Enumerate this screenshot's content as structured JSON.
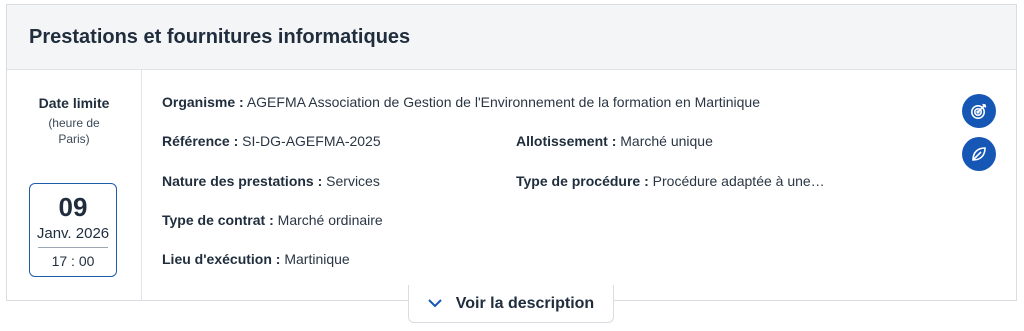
{
  "card": {
    "title": "Prestations et fournitures informatiques"
  },
  "deadline": {
    "label": "Date limite",
    "timezone": "(heure de Paris)",
    "day": "09",
    "month_year": "Janv. 2026",
    "time": "17 : 00"
  },
  "details": {
    "organisme": {
      "label": "Organisme :",
      "value": "AGEFMA Association de Gestion de l'Environnement de la formation en Martinique"
    },
    "reference": {
      "label": "Référence :",
      "value": "SI-DG-AGEFMA-2025"
    },
    "allotissement": {
      "label": "Allotissement :",
      "value": "Marché unique"
    },
    "nature": {
      "label": "Nature des prestations :",
      "value": "Services"
    },
    "procedure": {
      "label": "Type de procédure :",
      "value": "Procédure adaptée à une…"
    },
    "contrat": {
      "label": "Type de contrat :",
      "value": "Marché ordinaire"
    },
    "lieu": {
      "label": "Lieu d'exécution :",
      "value": "Martinique"
    }
  },
  "actions": {
    "target_icon": "target-icon",
    "leaf_icon": "leaf-icon",
    "accent": "#1657b5"
  },
  "description_toggle": {
    "label": "Voir la description",
    "icon": "chevron-down-icon"
  }
}
